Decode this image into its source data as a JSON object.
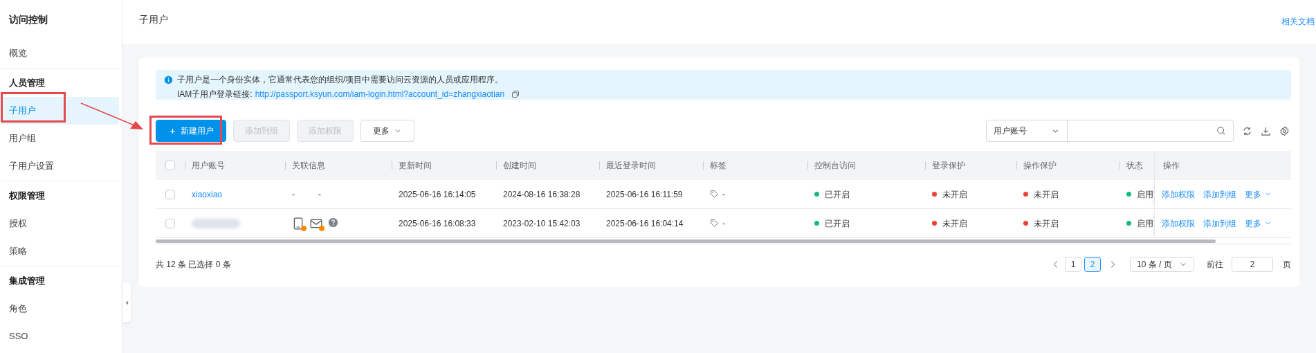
{
  "sidebar": {
    "title": "访问控制",
    "sections": [
      {
        "items": [
          {
            "label": "概览",
            "selected": false
          }
        ]
      },
      {
        "heading": "人员管理",
        "items": [
          {
            "label": "子用户",
            "selected": true
          },
          {
            "label": "用户组",
            "selected": false
          },
          {
            "label": "子用户设置",
            "selected": false
          }
        ]
      },
      {
        "heading": "权限管理",
        "items": [
          {
            "label": "授权",
            "selected": false
          },
          {
            "label": "策略",
            "selected": false
          }
        ]
      },
      {
        "heading": "集成管理",
        "items": [
          {
            "label": "角色",
            "selected": false
          },
          {
            "label": "SSO",
            "selected": false
          }
        ]
      }
    ]
  },
  "header": {
    "title": "子用户",
    "link": "相关文档"
  },
  "notice": {
    "text": "子用户是一个身份实体，它通常代表您的组织/项目中需要访问云资源的人员或应用程序。",
    "link_label": "IAM子用户登录链接:",
    "link": "http://passport.ksyun.com/iam-login.html?account_id=zhangxiaotian"
  },
  "toolbar": {
    "buttons": [
      {
        "label": "新建用户",
        "kind": "primary",
        "disabled": false
      },
      {
        "label": "添加到组",
        "kind": "default",
        "disabled": true
      },
      {
        "label": "添加权限",
        "kind": "default",
        "disabled": true
      },
      {
        "label": "更多",
        "kind": "dropdown",
        "disabled": false
      }
    ],
    "search": {
      "field": "用户账号"
    }
  },
  "table": {
    "all_checked": false,
    "columns": [
      "用户账号",
      "关联信息",
      "更新时间",
      "创建时间",
      "最近登录时间",
      "标签",
      "控制台访问",
      "登录保护",
      "操作保护",
      "状态",
      "操作"
    ],
    "rows": [
      {
        "checked": false,
        "account": {
          "text": "xiaoxiao",
          "redacted": false
        },
        "related": [
          {
            "kind": "text",
            "text": "-"
          },
          {
            "kind": "text",
            "text": "-"
          }
        ],
        "updated": "2025-06-16 16:14:05",
        "created": "2024-08-16 16:38:28",
        "last_login": "2025-06-16 16:11:59",
        "tag": "-",
        "console": {
          "text": "已开启",
          "color": "#12b886"
        },
        "login_protect": {
          "text": "未开启",
          "color": "#f04134"
        },
        "op_protect": {
          "text": "未开启",
          "color": "#f04134"
        },
        "status": {
          "text": "启用",
          "color": "#12b886"
        },
        "actions": [
          "添加权限",
          "添加到组",
          "更多"
        ]
      },
      {
        "checked": false,
        "account": {
          "redacted": true
        },
        "related": [
          {
            "kind": "phone",
            "warning": true
          },
          {
            "kind": "mail",
            "warning": true
          },
          {
            "kind": "help"
          }
        ],
        "updated": "2025-06-16 16:08:33",
        "created": "2023-02-10 15:42:03",
        "last_login": "2025-06-16 16:04:14",
        "tag": "-",
        "console": {
          "text": "已开启",
          "color": "#12b886"
        },
        "login_protect": {
          "text": "未开启",
          "color": "#f04134"
        },
        "op_protect": {
          "text": "未开启",
          "color": "#f04134"
        },
        "status": {
          "text": "启用",
          "color": "#12b886"
        },
        "actions": [
          "添加权限",
          "添加到组",
          "更多"
        ]
      }
    ]
  },
  "footer": {
    "summary": "共 12 条 已选择 0 条",
    "pages": [
      {
        "label": "1",
        "selected": false
      },
      {
        "label": "2",
        "selected": true
      }
    ],
    "page_size": "10 条 / 页",
    "goto_label": "前往",
    "goto_value": "2",
    "page_unit": "页"
  }
}
